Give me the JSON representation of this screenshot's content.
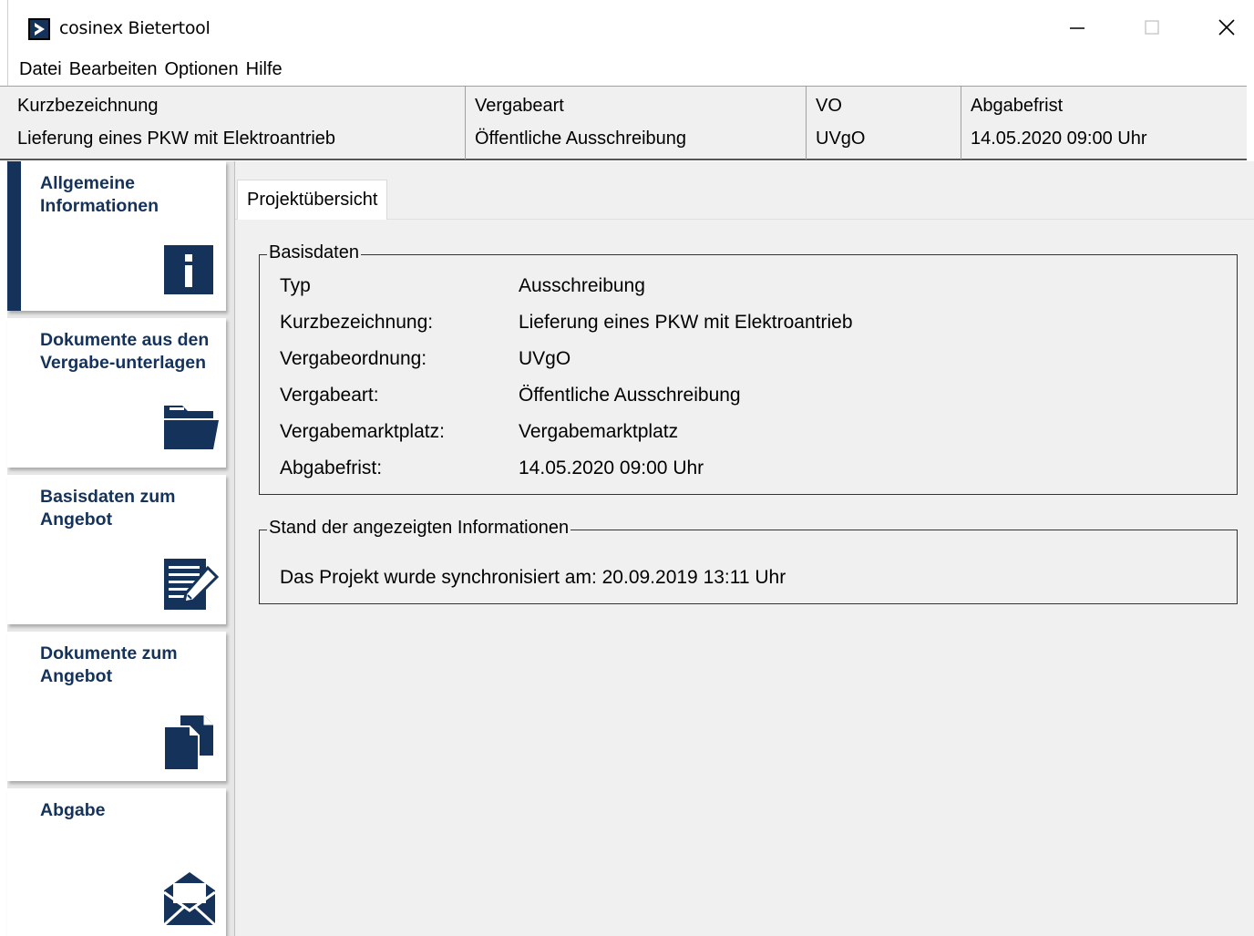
{
  "window": {
    "title": "cosinex Bietertool",
    "controls": {
      "minimize": "minimize-icon",
      "maximize": "maximize-icon",
      "close": "close-icon"
    }
  },
  "menu": {
    "items": [
      "Datei",
      "Bearbeiten",
      "Optionen",
      "Hilfe"
    ]
  },
  "header": {
    "columns": [
      {
        "label": "Kurzbezeichnung",
        "value": "Lieferung eines PKW mit Elektroantrieb"
      },
      {
        "label": "Vergabeart",
        "value": "Öffentliche Ausschreibung"
      },
      {
        "label": "VO",
        "value": "UVgO"
      },
      {
        "label": "Abgabefrist",
        "value": "14.05.2020 09:00 Uhr"
      }
    ]
  },
  "sidebar": {
    "items": [
      {
        "label": "Allgemeine Informationen",
        "icon": "info-icon",
        "active": true
      },
      {
        "label": "Dokumente aus den Vergabe-unterlagen",
        "icon": "folder-icon",
        "active": false
      },
      {
        "label": "Basisdaten zum Angebot",
        "icon": "edit-document-icon",
        "active": false
      },
      {
        "label": "Dokumente zum Angebot",
        "icon": "documents-icon",
        "active": false
      },
      {
        "label": "Abgabe",
        "icon": "envelope-icon",
        "active": false
      }
    ]
  },
  "content": {
    "tab": "Projektübersicht",
    "basisdaten": {
      "title": "Basisdaten",
      "rows": [
        {
          "key": "Typ",
          "value": "Ausschreibung"
        },
        {
          "key": "Kurzbezeichnung:",
          "value": "Lieferung eines PKW mit Elektroantrieb"
        },
        {
          "key": "Vergabeordnung:",
          "value": "UVgO"
        },
        {
          "key": "Vergabeart:",
          "value": "Öffentliche Ausschreibung"
        },
        {
          "key": "Vergabemarktplatz:",
          "value": "Vergabemarktplatz"
        },
        {
          "key": "Abgabefrist:",
          "value": "14.05.2020 09:00 Uhr"
        }
      ]
    },
    "stand": {
      "title": "Stand der angezeigten Informationen",
      "text": "Das Projekt wurde synchronisiert am: 20.09.2019 13:11 Uhr"
    }
  },
  "colors": {
    "accent": "#14325a",
    "panel": "#f0f0f0"
  }
}
